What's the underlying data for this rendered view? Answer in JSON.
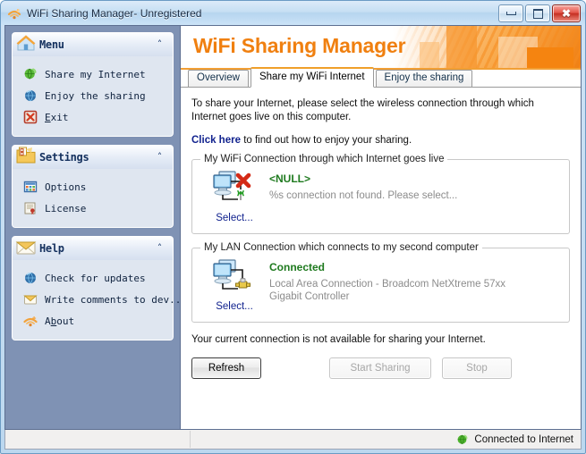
{
  "window": {
    "title": "WiFi Sharing Manager- Unregistered",
    "icon": "app-wifi-icon",
    "controls": {
      "minimize": "minimize-button",
      "maximize": "maximize-button",
      "close": "close-button"
    }
  },
  "sidebar": {
    "panels": [
      {
        "title": "Menu",
        "icon": "house-icon",
        "collapse": "˄",
        "items": [
          {
            "label": "Share my Internet",
            "icon": "green-globe-icon"
          },
          {
            "label": "Enjoy the sharing",
            "icon": "blue-globe-icon"
          },
          {
            "label": "Exit",
            "icon": "red-x-icon",
            "underline": "E"
          }
        ]
      },
      {
        "title": "Settings",
        "icon": "checklist-folder-icon",
        "collapse": "˄",
        "items": [
          {
            "label": "Options",
            "icon": "options-grid-icon"
          },
          {
            "label": "License",
            "icon": "certificate-icon"
          }
        ]
      },
      {
        "title": "Help",
        "icon": "envelope-icon",
        "collapse": "˄",
        "items": [
          {
            "label": "Check for updates",
            "icon": "blue-globe-icon"
          },
          {
            "label": "Write comments to dev...",
            "icon": "envelope-icon"
          },
          {
            "label": "About",
            "icon": "app-wifi-icon",
            "underline": "b"
          }
        ]
      }
    ]
  },
  "banner": {
    "title": "WiFi Sharing Manager",
    "accent_color": "#f08010"
  },
  "tabs": [
    {
      "label": "Overview",
      "active": false
    },
    {
      "label": "Share my WiFi Internet",
      "active": true
    },
    {
      "label": "Enjoy the sharing",
      "active": false
    }
  ],
  "main": {
    "intro": "To share your Internet, please select the wireless connection through which Internet goes live on this computer.",
    "link_text": "Click here",
    "link_suffix": "to find out how to enjoy your sharing.",
    "wifi_group": {
      "legend": "My WiFi Connection through which Internet goes live",
      "icon": "two-monitors-wifi-error-icon",
      "status": "<NULL>",
      "status_color": "#1f7a1f",
      "description": "%s connection not found. Please select...",
      "select_label": "Select..."
    },
    "lan_group": {
      "legend": "My LAN Connection which connects to my second computer",
      "icon": "two-monitors-lan-icon",
      "status": "Connected",
      "status_color": "#1f7a1f",
      "description": "Local Area Connection - Broadcom NetXtreme 57xx Gigabit Controller",
      "select_label": "Select..."
    },
    "warning": "Your current connection is not available for sharing your Internet.",
    "buttons": {
      "refresh": "Refresh",
      "start_sharing": "Start Sharing",
      "stop": "Stop"
    }
  },
  "statusbar": {
    "left_text": "",
    "icon": "green-globe-icon",
    "right_text": "Connected to Internet"
  }
}
